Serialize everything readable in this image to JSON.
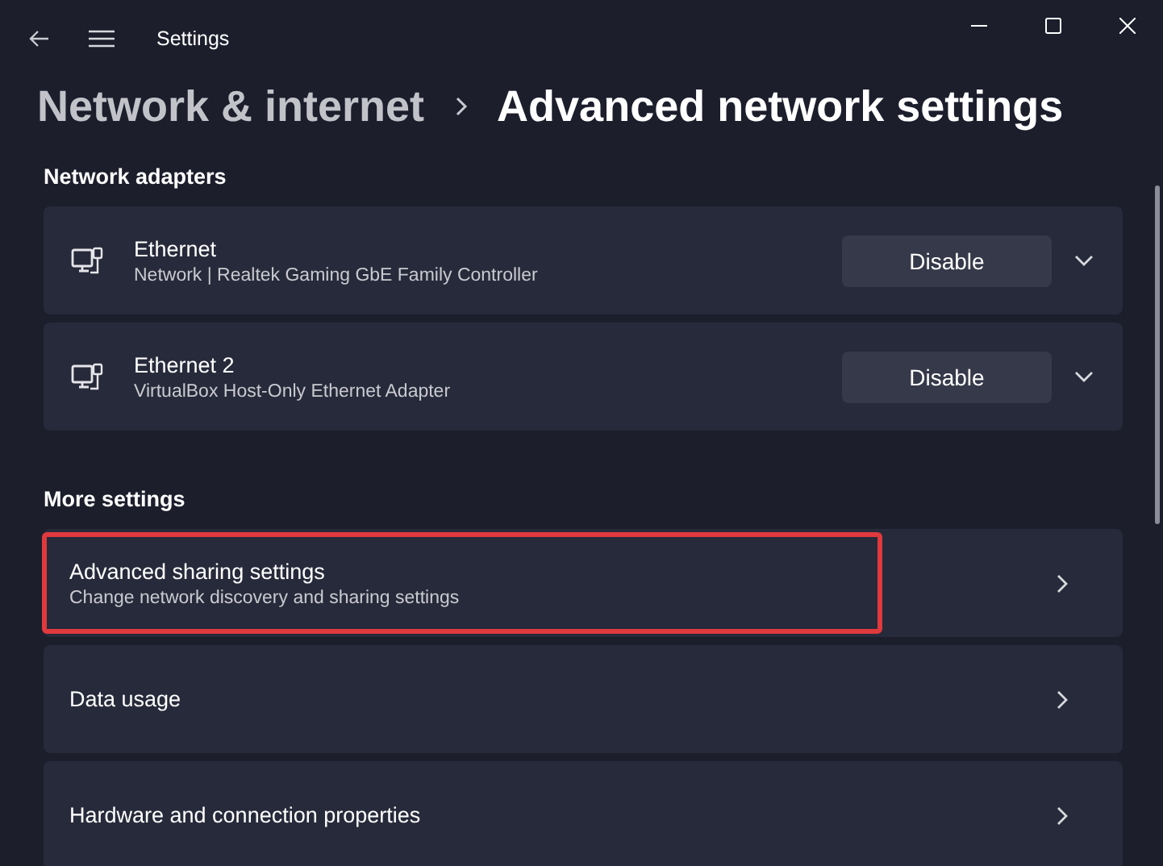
{
  "window": {
    "title": "Settings"
  },
  "breadcrumb": [
    {
      "label": "Network & internet",
      "current": false
    },
    {
      "label": "Advanced network settings",
      "current": true
    }
  ],
  "sections": [
    {
      "heading": "Network adapters",
      "items": [
        {
          "kind": "adapter",
          "title": "Ethernet",
          "subtitle": "Network | Realtek Gaming GbE Family Controller",
          "button": "Disable",
          "expanded": false
        },
        {
          "kind": "adapter",
          "title": "Ethernet 2",
          "subtitle": "VirtualBox Host-Only Ethernet Adapter",
          "button": "Disable",
          "expanded": false
        }
      ]
    },
    {
      "heading": "More settings",
      "items": [
        {
          "kind": "link",
          "title": "Advanced sharing settings",
          "subtitle": "Change network discovery and sharing settings",
          "highlighted": true
        },
        {
          "kind": "link",
          "title": "Data usage",
          "highlighted": false
        },
        {
          "kind": "link",
          "title": "Hardware and connection properties",
          "highlighted": false
        }
      ]
    }
  ]
}
